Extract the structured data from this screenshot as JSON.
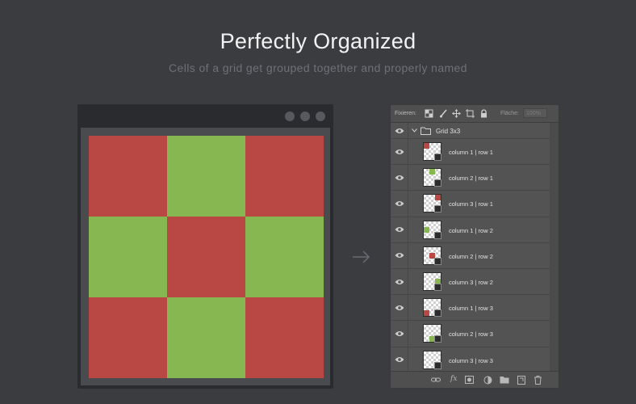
{
  "header": {
    "title": "Perfectly Organized",
    "subtitle": "Cells of a grid get grouped together and properly named"
  },
  "colors": {
    "red": "#b94744",
    "green": "#87b751",
    "background": "#3b3c40"
  },
  "grid_cells": [
    "red",
    "green",
    "red",
    "green",
    "red",
    "green",
    "red",
    "green",
    "red"
  ],
  "panel": {
    "lock_label": "Fixieren:",
    "fill_label": "Fläche:",
    "fill_value": "100%",
    "group_name": "Grid 3x3",
    "layers": [
      {
        "label": "column 1 | row 1",
        "color": "red",
        "col": 0,
        "row": 0
      },
      {
        "label": "column 2 | row 1",
        "color": "green",
        "col": 1,
        "row": 0
      },
      {
        "label": "column 3 | row 1",
        "color": "red",
        "col": 2,
        "row": 0
      },
      {
        "label": "column 1 | row 2",
        "color": "green",
        "col": 0,
        "row": 1
      },
      {
        "label": "column 2 | row 2",
        "color": "red",
        "col": 1,
        "row": 1
      },
      {
        "label": "column 3 | row 2",
        "color": "green",
        "col": 2,
        "row": 1
      },
      {
        "label": "column 1 | row 3",
        "color": "red",
        "col": 0,
        "row": 2
      },
      {
        "label": "column 2 | row 3",
        "color": "green",
        "col": 1,
        "row": 2
      },
      {
        "label": "column 3 | row 3",
        "color": "red",
        "col": 2,
        "row": 2
      }
    ]
  },
  "icons": {
    "lock_tools": [
      "lock-transparent-pixels-icon",
      "lock-image-pixels-icon",
      "lock-position-icon",
      "lock-artboard-icon",
      "lock-all-icon"
    ],
    "bottom_tools": [
      "link-layers-icon",
      "fx-icon",
      "add-mask-icon",
      "adjustment-layer-icon",
      "new-group-icon",
      "new-layer-icon",
      "delete-layer-icon"
    ]
  }
}
